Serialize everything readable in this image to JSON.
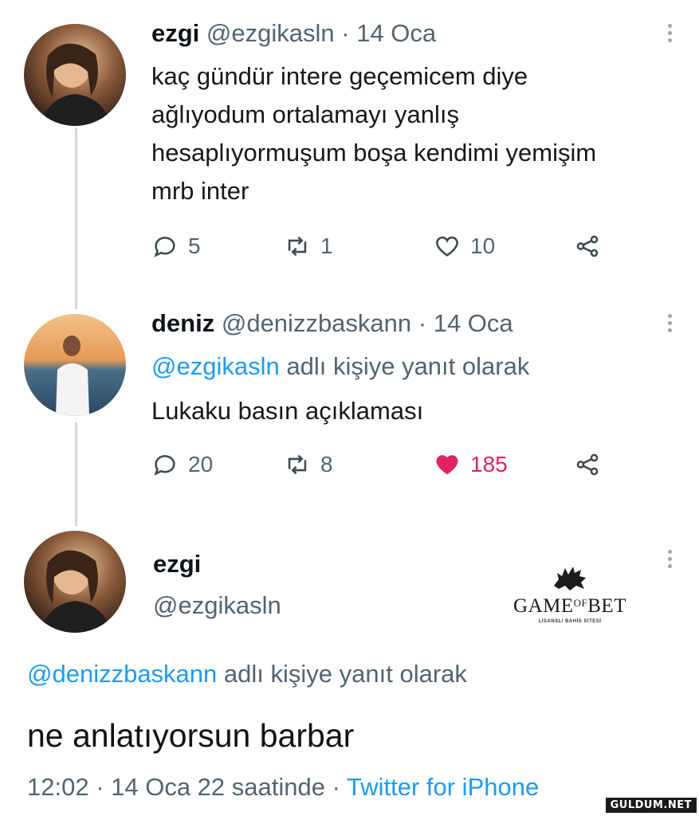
{
  "tweets": [
    {
      "name": "ezgi",
      "handle": "@ezgikasln",
      "time": "· 14 Oca",
      "text": [
        "kaç gündür intere geçemicem diye",
        "ağlıyodum ortalamayı yanlış",
        "hesaplıyormuşum boşa kendimi yemişim",
        "mrb inter"
      ],
      "replies": "5",
      "retweets": "1",
      "likes": "10",
      "avatar_icon": "user-photo-avatar"
    },
    {
      "name": "deniz",
      "handle": "@denizzbaskann",
      "time": "· 14 Oca",
      "replying_mention": "@ezgikasln",
      "replying_suffix": "adlı kişiye yanıt olarak",
      "text": [
        "Lukaku basın açıklaması"
      ],
      "replies": "20",
      "retweets": "8",
      "likes": "185",
      "liked": true,
      "like_color": "#e0245e",
      "avatar_icon": "user-photo-avatar"
    }
  ],
  "focus": {
    "name": "ezgi",
    "handle": "@ezgikasln",
    "replying_mention": "@denizzbaskann",
    "replying_suffix": "adlı kişiye yanıt olarak",
    "text": "ne anlatıyorsun barbar",
    "timestamp": "12:02 · 14 Oca 22 saatinde ·",
    "source": "Twitter for iPhone"
  },
  "brand": {
    "title_left": "GAME",
    "title_mid": "OF",
    "title_right": "BET",
    "subtitle": "LİSANSLI BAHİS SİTESİ",
    "icon": "wolf-icon"
  },
  "watermark": "GULDUM.NET",
  "colors": {
    "link": "#1d9bf0",
    "secondary_text": "#536471",
    "thread_line": "#cfd9de",
    "like": "#e0245e"
  }
}
